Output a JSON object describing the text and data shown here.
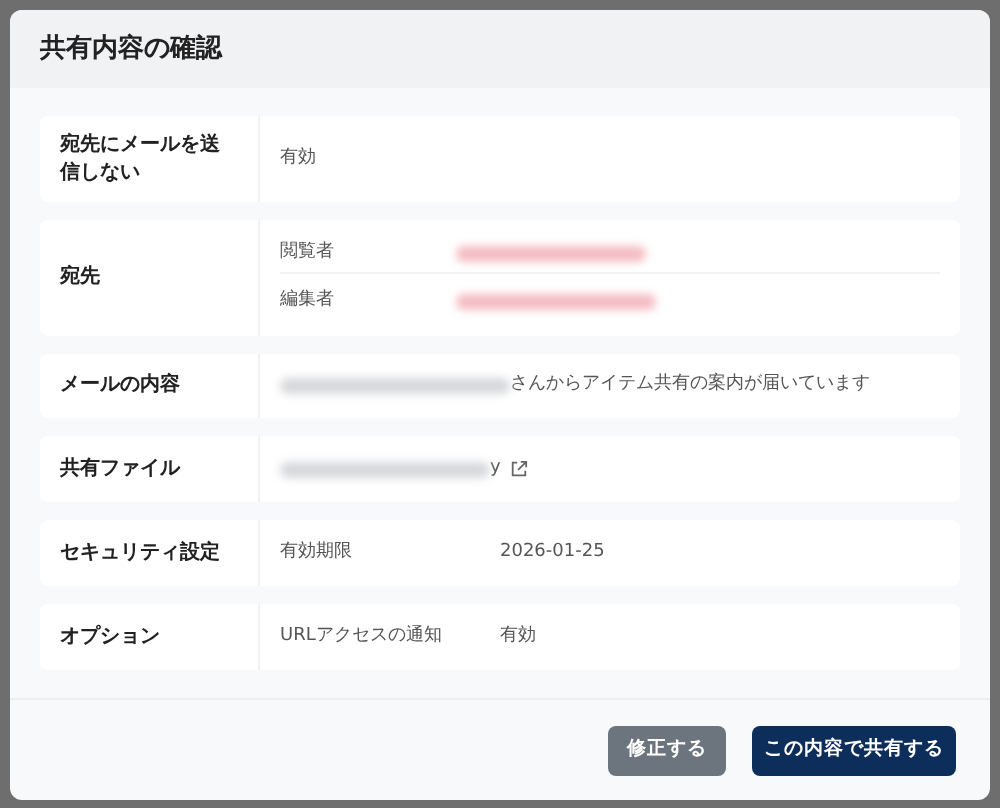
{
  "dialog": {
    "title": "共有内容の確認",
    "rows": [
      {
        "label": "宛先にメールを送信しない",
        "kind": "text",
        "value": "有効"
      },
      {
        "label": "宛先",
        "kind": "recipients",
        "entries": [
          {
            "role": "閲覧者"
          },
          {
            "role": "編集者"
          }
        ]
      },
      {
        "label": "メールの内容",
        "kind": "message",
        "text": "さんからアイテム共有の案内が届いています"
      },
      {
        "label": "共有ファイル",
        "kind": "file",
        "text": "y"
      },
      {
        "label": "セキュリティ設定",
        "kind": "pair",
        "key": "有効期限",
        "value": "2026-01-25"
      },
      {
        "label": "オプション",
        "kind": "pair",
        "key": "URLアクセスの通知",
        "value": "有効"
      }
    ],
    "buttons": [
      {
        "label": "修正する",
        "kind": "secondary"
      },
      {
        "label": "この内容で共有する",
        "kind": "primary"
      }
    ]
  }
}
